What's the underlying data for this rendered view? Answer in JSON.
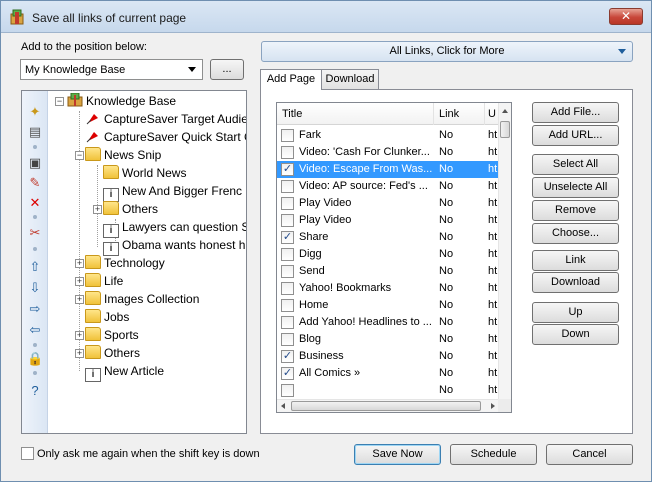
{
  "window": {
    "title": "Save all links of current page",
    "close_glyph": "✕"
  },
  "position": {
    "label": "Add to the position below:",
    "selected": "My Knowledge Base",
    "browse_label": "..."
  },
  "links_dropdown": {
    "label": "All Links, Click for More"
  },
  "tabs": [
    {
      "label": "Add Page",
      "active": true
    },
    {
      "label": "Download",
      "active": false
    }
  ],
  "tree": {
    "nodes": [
      {
        "label": "Knowledge Base",
        "icon": "knowledge-base-icon"
      },
      {
        "label": "CaptureSaver Target Audie",
        "icon": "pin-icon"
      },
      {
        "label": "CaptureSaver Quick Start G",
        "icon": "pin-icon"
      },
      {
        "label": "News Snip",
        "icon": "folder-icon"
      },
      {
        "label": "World News",
        "icon": "folder-icon"
      },
      {
        "label": "New And Bigger Frenc",
        "icon": "info-page-icon"
      },
      {
        "label": "Others",
        "icon": "folder-icon"
      },
      {
        "label": "Lawyers can question S",
        "icon": "info-page-icon"
      },
      {
        "label": "Obama wants honest h",
        "icon": "info-page-icon"
      },
      {
        "label": "Technology",
        "icon": "folder-icon"
      },
      {
        "label": "Life",
        "icon": "folder-icon"
      },
      {
        "label": "Images Collection",
        "icon": "folder-icon"
      },
      {
        "label": "Jobs",
        "icon": "folder-icon"
      },
      {
        "label": "Sports",
        "icon": "folder-icon"
      },
      {
        "label": "Others",
        "icon": "folder-icon"
      },
      {
        "label": "New Article",
        "icon": "info-page-icon"
      }
    ]
  },
  "list": {
    "columns": [
      "Title",
      "Link",
      "U"
    ],
    "rows": [
      {
        "title": "Fark",
        "link": "No",
        "url": "ht",
        "checked": false,
        "selected": false
      },
      {
        "title": "Video: 'Cash For Clunker...",
        "link": "No",
        "url": "ht",
        "checked": false,
        "selected": false
      },
      {
        "title": "Video: Escape From Was...",
        "link": "No",
        "url": "ht",
        "checked": true,
        "selected": true
      },
      {
        "title": "Video: AP source: Fed's ...",
        "link": "No",
        "url": "ht",
        "checked": false,
        "selected": false
      },
      {
        "title": "Play Video",
        "link": "No",
        "url": "ht",
        "checked": false,
        "selected": false
      },
      {
        "title": "Play Video",
        "link": "No",
        "url": "ht",
        "checked": false,
        "selected": false
      },
      {
        "title": "Share",
        "link": "No",
        "url": "ht",
        "checked": true,
        "selected": false
      },
      {
        "title": "Digg",
        "link": "No",
        "url": "ht",
        "checked": false,
        "selected": false
      },
      {
        "title": "Send",
        "link": "No",
        "url": "ht",
        "checked": false,
        "selected": false
      },
      {
        "title": "Yahoo! Bookmarks",
        "link": "No",
        "url": "ht",
        "checked": false,
        "selected": false
      },
      {
        "title": "Home",
        "link": "No",
        "url": "ht",
        "checked": false,
        "selected": false
      },
      {
        "title": "Add Yahoo! Headlines to ...",
        "link": "No",
        "url": "ht",
        "checked": false,
        "selected": false
      },
      {
        "title": "Blog",
        "link": "No",
        "url": "ht",
        "checked": false,
        "selected": false
      },
      {
        "title": "Business",
        "link": "No",
        "url": "ht",
        "checked": true,
        "selected": false
      },
      {
        "title": "All Comics »",
        "link": "No",
        "url": "ht",
        "checked": true,
        "selected": false
      },
      {
        "title": "",
        "link": "No",
        "url": "ht",
        "checked": false,
        "selected": false
      }
    ]
  },
  "side_buttons": {
    "add_file": "Add File...",
    "add_url": "Add URL...",
    "select_all": "Select All",
    "unselect_all": "Unselecte All",
    "remove": "Remove",
    "choose": "Choose...",
    "link": "Link",
    "download": "Download",
    "up": "Up",
    "down": "Down"
  },
  "footer": {
    "shift_checkbox_label": "Only ask me again when the shift key is down",
    "save_now": "Save Now",
    "schedule": "Schedule",
    "cancel": "Cancel"
  },
  "colors": {
    "selection": "#3399ff",
    "accent": "#1f5e9c"
  }
}
